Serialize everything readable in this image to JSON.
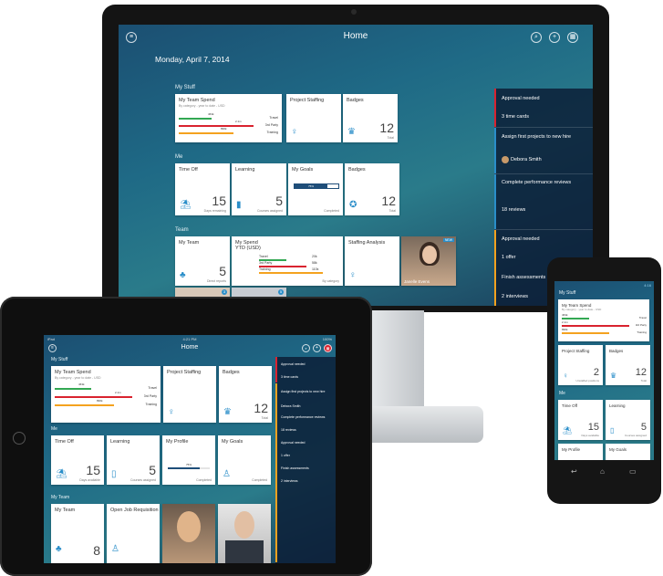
{
  "desktop": {
    "header": {
      "title": "Home"
    },
    "date": "Monday, April 7, 2014",
    "sections": {
      "my_stuff": "My Stuff",
      "me": "Me",
      "team": "Team"
    },
    "my_team_spend": {
      "title": "My Team Spend",
      "subtitle": "By category - year to date - USD",
      "rows": [
        {
          "label": "Travel",
          "value": "463k",
          "color": "#33a853"
        },
        {
          "label": "3rd Party",
          "value": "2.1m",
          "color": "#d9232f"
        },
        {
          "label": "Training",
          "value": "896k",
          "color": "#f4a21f"
        }
      ]
    },
    "project_staffing": {
      "title": "Project Staffing"
    },
    "badges_top": {
      "title": "Badges",
      "value": "12",
      "unit": "Total"
    },
    "time_off": {
      "title": "Time Off",
      "value": "15",
      "unit": "Days remaining"
    },
    "learning": {
      "title": "Learning",
      "value": "5",
      "unit": "Courses assigned"
    },
    "my_goals": {
      "title": "My Goals",
      "progress_label": "75%",
      "progress": 0.75,
      "unit": "Completed"
    },
    "badges_me": {
      "title": "Badges",
      "value": "12",
      "unit": "Total"
    },
    "my_team": {
      "title": "My Team",
      "value": "5",
      "unit": "Direct reports"
    },
    "my_spend": {
      "title": "My Spend",
      "subtitle": "YTD (USD)",
      "rows": [
        {
          "label": "Travel",
          "value": "20k",
          "color": "#33a853"
        },
        {
          "label": "3rd Party",
          "value": "58k",
          "color": "#d9232f"
        },
        {
          "label": "Training",
          "value": "110k",
          "color": "#f4a21f"
        }
      ],
      "footer": "By category"
    },
    "staffing_analysis": {
      "title": "Staffing Analysis"
    },
    "person_card": {
      "name": "Janelle Evens",
      "badge": "NEW"
    },
    "small_badges": [
      "3",
      "5"
    ],
    "sidebar": [
      {
        "text": "Approval needed",
        "accent": "#d9232f"
      },
      {
        "text": "3 time cards"
      },
      {
        "text": "Assign first projects to new hire",
        "accent": "#2a8ec9"
      },
      {
        "text": "Debora Smith"
      },
      {
        "text": "Complete performance reviews",
        "accent": "#2a8ec9"
      },
      {
        "text": "18 reviews"
      },
      {
        "text": "Approval needed",
        "accent": "#f4a21f"
      },
      {
        "text": "1 offer"
      },
      {
        "text": "Finish assessments",
        "accent": "#f4a21f"
      },
      {
        "text": "2 interviews"
      }
    ]
  },
  "tablet": {
    "status_left": "iPad",
    "status_time": "4:21 PM",
    "status_right": "100%",
    "header": {
      "title": "Home"
    },
    "sections": {
      "my_stuff": "My Stuff",
      "me": "Me",
      "my_team": "My Team"
    },
    "my_team_spend": {
      "title": "My Team Spend",
      "subtitle": "By category - year to date - USD",
      "rows": [
        {
          "label": "Travel",
          "value": "463k"
        },
        {
          "label": "3rd Party",
          "value": "2.1m"
        },
        {
          "label": "Training",
          "value": "896k"
        }
      ]
    },
    "project_staffing": {
      "title": "Project Staffing"
    },
    "badges": {
      "title": "Badges",
      "value": "12",
      "unit": "Total"
    },
    "time_off": {
      "title": "Time Off",
      "value": "15",
      "unit": "Days available"
    },
    "learning": {
      "title": "Learning",
      "value": "5",
      "unit": "Courses assigned"
    },
    "my_profile": {
      "title": "My Profile",
      "progress_label": "75%",
      "progress": 0.75,
      "unit": "Completed"
    },
    "my_goals": {
      "title": "My Goals",
      "unit": "Completed"
    },
    "my_team": {
      "title": "My Team",
      "value": "8"
    },
    "open_job": {
      "title": "Open Job Requisition"
    },
    "sidebar": [
      {
        "text": "Approval needed"
      },
      {
        "text": "3 time cards"
      },
      {
        "text": "Assign first projects to new hire"
      },
      {
        "text": "Debora Smith"
      },
      {
        "text": "Complete performance reviews"
      },
      {
        "text": "18 reviews"
      },
      {
        "text": "Approval needed"
      },
      {
        "text": "1 offer"
      },
      {
        "text": "Finish assessments"
      },
      {
        "text": "2 interviews"
      }
    ]
  },
  "phone": {
    "status_time": "4:16",
    "sections": {
      "my_stuff": "My Stuff",
      "me": "Me"
    },
    "my_team_spend": {
      "title": "My Team Spend",
      "subtitle": "By category - year to date - USD",
      "rows": [
        {
          "label": "Travel",
          "value": "463k"
        },
        {
          "label": "3rd Party",
          "value": "2.1m"
        },
        {
          "label": "Training",
          "value": "896k"
        }
      ]
    },
    "project_staffing": {
      "title": "Project Staffing",
      "value": "2",
      "unit": "Unstaffed positions"
    },
    "badges": {
      "title": "Badges",
      "value": "12",
      "unit": "Total"
    },
    "time_off": {
      "title": "Time Off",
      "value": "15",
      "unit": "Days available"
    },
    "learning": {
      "title": "Learning",
      "value": "5",
      "unit": "Courses assigned"
    },
    "my_profile": {
      "title": "My Profile"
    },
    "my_goals": {
      "title": "My Goals"
    }
  }
}
